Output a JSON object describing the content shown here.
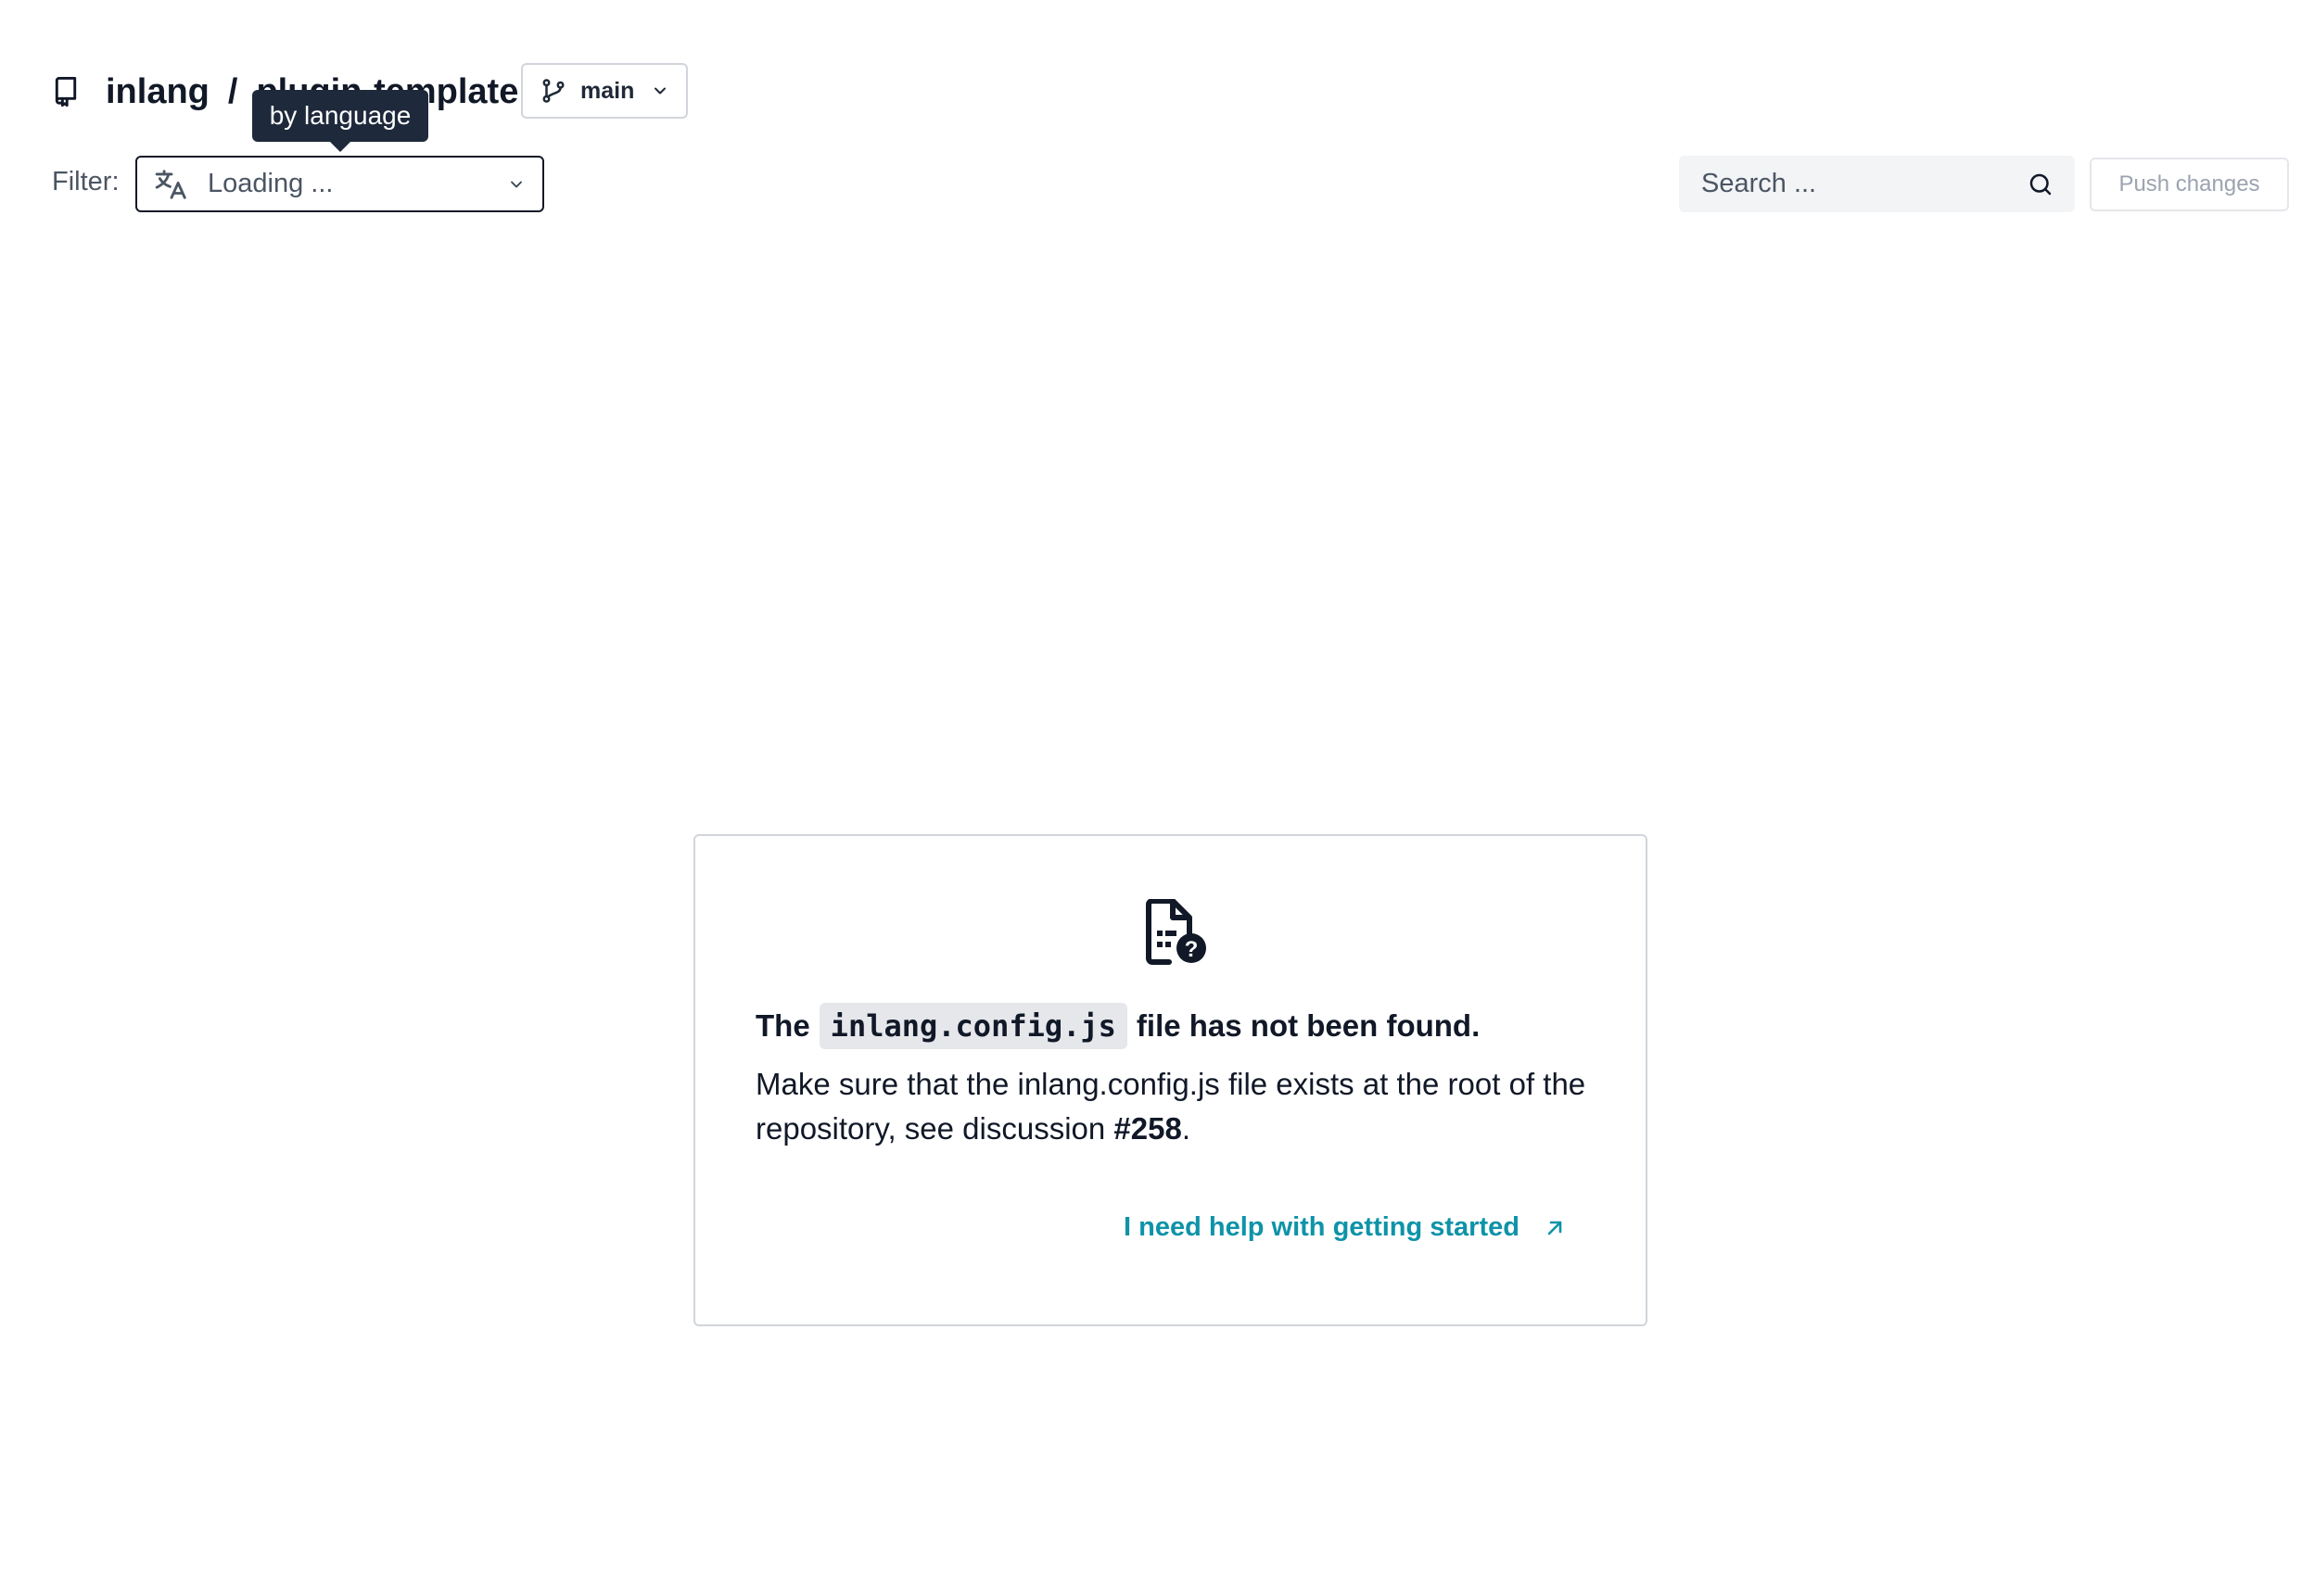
{
  "header": {
    "owner": "inlang",
    "separator": "/",
    "repo": "plugin-template",
    "branch": "main"
  },
  "tooltip": {
    "text": "by language"
  },
  "filter": {
    "label": "Filter:",
    "value": "Loading ..."
  },
  "search": {
    "placeholder": "Search ..."
  },
  "push": {
    "label": "Push changes"
  },
  "card": {
    "title_prefix": "The",
    "title_code": "inlang.config.js",
    "title_suffix": "file has not been found.",
    "desc_text": "Make sure that the inlang.config.js file exists at the root of the repository, see discussion",
    "desc_ref": "#258",
    "desc_end": ".",
    "help_link": "I need help with getting started"
  },
  "icons": {
    "repo": "repo-icon",
    "branch": "git-branch-icon",
    "language": "translate-icon",
    "search": "search-icon",
    "file_missing": "file-question-icon",
    "external": "arrow-up-right-icon"
  },
  "colors": {
    "text": "#111827",
    "muted": "#4b5563",
    "tooltip_bg": "#1e293b",
    "link": "#0e93a8",
    "border": "#d1d5db",
    "input_bg": "#f3f4f6"
  }
}
